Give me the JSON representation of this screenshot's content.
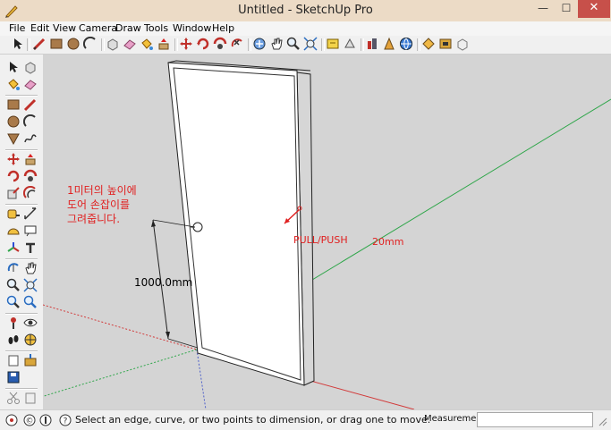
{
  "window": {
    "title": "Untitled - SketchUp Pro",
    "minimize_glyph": "—",
    "maximize_glyph": "☐",
    "close_glyph": "✕"
  },
  "menu": [
    "File",
    "Edit",
    "View",
    "Camera",
    "Draw",
    "Tools",
    "Window",
    "Help"
  ],
  "toolbar_top": {
    "icons": [
      "select-icon",
      "line-icon",
      "rectangle-icon",
      "circle-icon",
      "arc-icon",
      "make-component-icon",
      "eraser-icon",
      "paint-bucket-icon",
      "push-pull-icon",
      "move-icon",
      "rotate-icon",
      "follow-me-icon",
      "orbit-icon",
      "pan-icon",
      "zoom-icon",
      "zoom-extents-icon",
      "get-models-icon",
      "share-model-icon",
      "component-icon",
      "model-info-icon",
      "warehouse-icon",
      "extension-icon",
      "layout-icon",
      "style-icon"
    ]
  },
  "toolbar_left": {
    "icons": [
      "select-icon",
      "make-component-icon",
      "paint-bucket-icon",
      "eraser-icon",
      "rectangle-icon",
      "line-icon",
      "circle-icon",
      "arc-icon",
      "polygon-icon",
      "freehand-icon",
      "move-icon",
      "push-pull-icon",
      "rotate-icon",
      "follow-me-icon",
      "scale-icon",
      "offset-icon",
      "tape-measure-icon",
      "dimension-icon",
      "protractor-icon",
      "text-icon",
      "axes-icon",
      "3d-text-icon",
      "orbit-icon",
      "pan-icon",
      "zoom-icon",
      "zoom-window-icon",
      "zoom-extents-icon",
      "previous-view-icon",
      "position-camera-icon",
      "look-around-icon",
      "walk-icon",
      "section-plane-icon",
      "get-models-icon",
      "share-model-icon",
      "component-options-icon",
      "scenes-icon"
    ]
  },
  "viewport": {
    "annotation_korean": [
      "1미터의 높이에",
      "도어 손잡이를",
      "그려줍니다."
    ],
    "pushpull_label": "PULL/PUSH",
    "thickness_label": "20mm",
    "dimension_label": "1000.0mm",
    "colors": {
      "background": "#d4d4d4",
      "annotation": "#e02020",
      "axis_red": "#d23b3b",
      "axis_green": "#2fa64a",
      "axis_blue": "#4d5fc9"
    }
  },
  "statusbar": {
    "icons": [
      "geo-location-icon",
      "credits-icon",
      "user-icon",
      "help-icon"
    ],
    "message": "Select an edge, curve, or two points to dimension, or drag one to move.",
    "measurements_label": "Measurements",
    "measurements_value": ""
  }
}
